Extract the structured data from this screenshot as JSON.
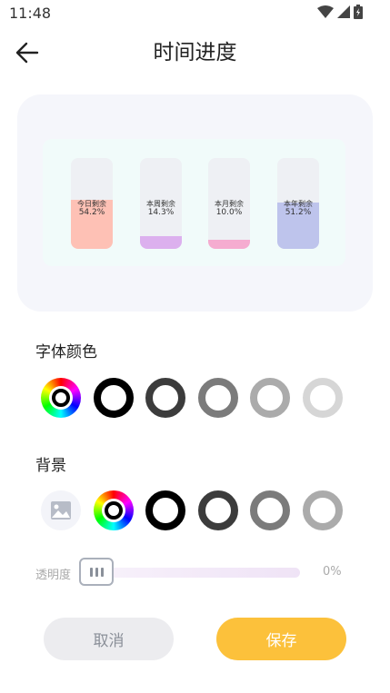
{
  "status": {
    "time": "11:48"
  },
  "header": {
    "title": "时间进度"
  },
  "preview": {
    "bars": [
      {
        "label": "今日剩余",
        "percent": "54.2%",
        "fraction": 0.542,
        "color": "#fec1b5"
      },
      {
        "label": "本周剩余",
        "percent": "14.3%",
        "fraction": 0.143,
        "color": "#dcb0ee"
      },
      {
        "label": "本月剩余",
        "percent": "10.0%",
        "fraction": 0.1,
        "color": "#f5acd0"
      },
      {
        "label": "本年剩余",
        "percent": "51.2%",
        "fraction": 0.512,
        "color": "#bec4ec"
      }
    ]
  },
  "font_color": {
    "title": "字体颜色",
    "swatches": [
      {
        "type": "wheel"
      },
      {
        "type": "ring",
        "color": "#000000"
      },
      {
        "type": "ring",
        "color": "#3c3c3c"
      },
      {
        "type": "ring",
        "color": "#7b7b7b"
      },
      {
        "type": "ring",
        "color": "#ababab"
      },
      {
        "type": "ring",
        "color": "#d6d6d6"
      },
      {
        "type": "ring",
        "color": "#fde9a8"
      }
    ]
  },
  "background": {
    "title": "背景",
    "swatches": [
      {
        "type": "image"
      },
      {
        "type": "wheel"
      },
      {
        "type": "ring",
        "color": "#000000"
      },
      {
        "type": "ring",
        "color": "#3c3c3c"
      },
      {
        "type": "ring",
        "color": "#7b7b7b"
      },
      {
        "type": "ring",
        "color": "#ababab"
      },
      {
        "type": "ring",
        "color": "#d6d6d6"
      }
    ]
  },
  "opacity": {
    "label": "透明度",
    "value": "0%",
    "fraction": 0
  },
  "actions": {
    "cancel": "取消",
    "save": "保存"
  }
}
